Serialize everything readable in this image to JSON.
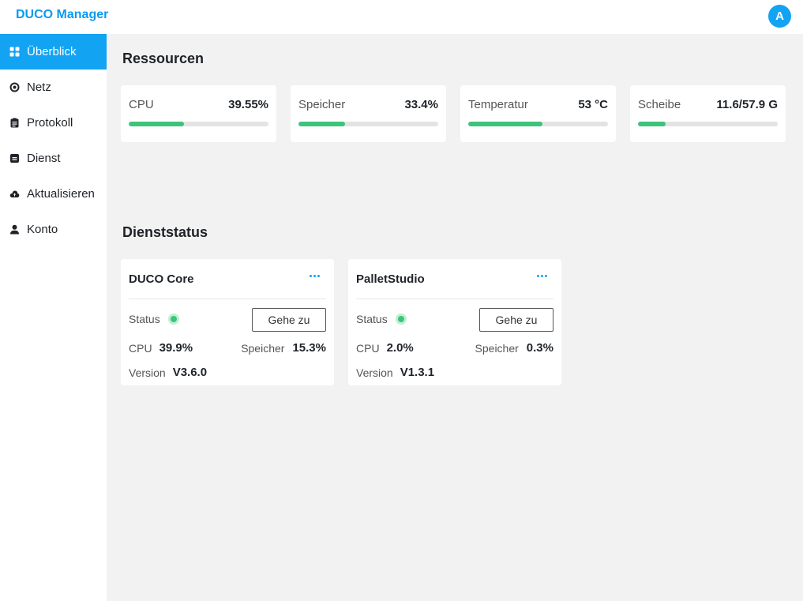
{
  "app": {
    "title": "DUCO Manager",
    "avatar_letter": "A"
  },
  "sidebar": {
    "items": [
      {
        "label": "Überblick",
        "icon": "grid-icon",
        "active": true
      },
      {
        "label": "Netz",
        "icon": "target-icon"
      },
      {
        "label": "Protokoll",
        "icon": "clipboard-icon"
      },
      {
        "label": "Dienst",
        "icon": "box-icon"
      },
      {
        "label": "Aktualisieren",
        "icon": "cloud-icon"
      },
      {
        "label": "Konto",
        "icon": "user-icon"
      }
    ]
  },
  "resources": {
    "title": "Ressourcen",
    "cards": [
      {
        "label": "CPU",
        "value": "39.55%",
        "fill": 0.3955
      },
      {
        "label": "Speicher",
        "value": "33.4%",
        "fill": 0.334
      },
      {
        "label": "Temperatur",
        "value": "53 °C",
        "fill": 0.53
      },
      {
        "label": "Scheibe",
        "value": "11.6/57.9 G",
        "fill": 0.2
      }
    ]
  },
  "services": {
    "title": "Dienststatus",
    "labels": {
      "status": "Status",
      "cpu": "CPU",
      "memory": "Speicher",
      "version": "Version",
      "goto": "Gehe zu"
    },
    "cards": [
      {
        "name": "DUCO Core",
        "status": "running",
        "cpu": "39.9%",
        "memory": "15.3%",
        "version": "V3.6.0"
      },
      {
        "name": "PalletStudio",
        "status": "running",
        "cpu": "2.0%",
        "memory": "0.3%",
        "version": "V1.3.1"
      }
    ]
  },
  "colors": {
    "accent": "#13a3f3",
    "brand": "#0a9af0",
    "progress": "#3cc47c",
    "status_ok": "#3cc47c"
  }
}
